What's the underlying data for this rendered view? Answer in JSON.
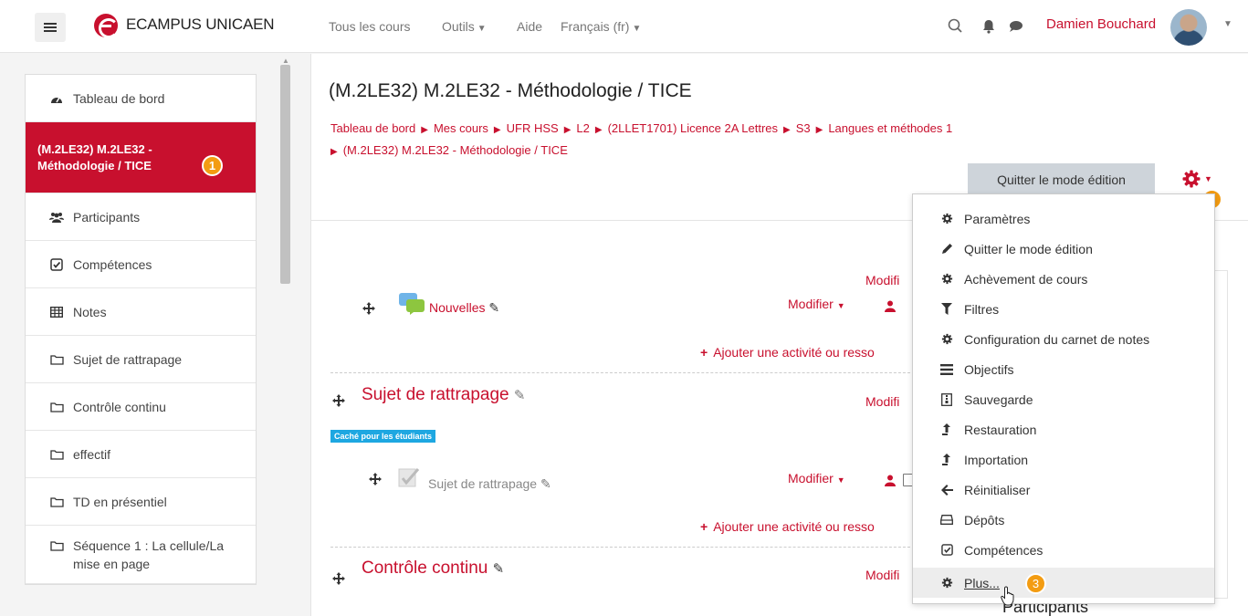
{
  "navbar": {
    "site_name": "ECAMPUS UNICAEN",
    "links": {
      "courses": "Tous les cours",
      "tools": "Outils",
      "help": "Aide",
      "language": "Français (fr)"
    },
    "user_name": "Damien Bouchard"
  },
  "drawer": {
    "items": [
      {
        "label": "Tableau de bord",
        "icon": "dashboard-icon"
      },
      {
        "label": "(M.2LE32) M.2LE32 - Méthodologie / TICE",
        "icon": "none",
        "active": true,
        "badge": "1"
      },
      {
        "label": "Participants",
        "icon": "users-icon"
      },
      {
        "label": "Compétences",
        "icon": "check-square-icon"
      },
      {
        "label": "Notes",
        "icon": "table-icon"
      },
      {
        "label": "Sujet de rattrapage",
        "icon": "folder-icon"
      },
      {
        "label": "Contrôle continu",
        "icon": "folder-icon"
      },
      {
        "label": "effectif",
        "icon": "folder-icon"
      },
      {
        "label": "TD en présentiel",
        "icon": "folder-icon"
      },
      {
        "label": "Séquence 1 : La cellule/La mise en page",
        "icon": "folder-icon"
      }
    ]
  },
  "course": {
    "title": "(M.2LE32) M.2LE32 - Méthodologie / TICE",
    "breadcrumb": [
      "Tableau de bord",
      "Mes cours",
      "UFR HSS",
      "L2",
      "(2LLET1701) Licence 2A Lettres",
      "S3",
      "Langues et méthodes 1",
      "(M.2LE32) M.2LE32 - Méthodologie / TICE"
    ],
    "quit_edit_label": "Quitter le mode édition",
    "gear_badge": "2"
  },
  "content": {
    "edit_label": "Modifier",
    "edit_label_truncated": "Modifi",
    "add_activity_label": "Ajouter une activité ou resso",
    "news_label": "Nouvelles",
    "sections": [
      {
        "title": "Sujet de rattrapage",
        "hidden_badge": "Caché pour les étudiants",
        "activity": "Sujet de rattrapage"
      },
      {
        "title": "Contrôle continu"
      }
    ]
  },
  "dropdown": {
    "items": [
      {
        "label": "Paramètres",
        "icon": "gear-icon"
      },
      {
        "label": "Quitter le mode édition",
        "icon": "pencil-icon"
      },
      {
        "label": "Achèvement de cours",
        "icon": "gear-icon"
      },
      {
        "label": "Filtres",
        "icon": "filter-icon"
      },
      {
        "label": "Configuration du carnet de notes",
        "icon": "gear-icon"
      },
      {
        "label": "Objectifs",
        "icon": "list-icon"
      },
      {
        "label": "Sauvegarde",
        "icon": "archive-icon"
      },
      {
        "label": "Restauration",
        "icon": "upload-icon"
      },
      {
        "label": "Importation",
        "icon": "upload-icon"
      },
      {
        "label": "Réinitialiser",
        "icon": "arrow-left-icon"
      },
      {
        "label": "Dépôts",
        "icon": "hdd-icon"
      },
      {
        "label": "Compétences",
        "icon": "check-square-icon"
      },
      {
        "label": "Plus...",
        "icon": "gear-icon",
        "badge": "3"
      }
    ]
  },
  "right_block": {
    "title": "Participants"
  },
  "colors": {
    "brand": "#c8102e",
    "badge": "#f39c12",
    "hidden_badge": "#1ea7e1"
  }
}
